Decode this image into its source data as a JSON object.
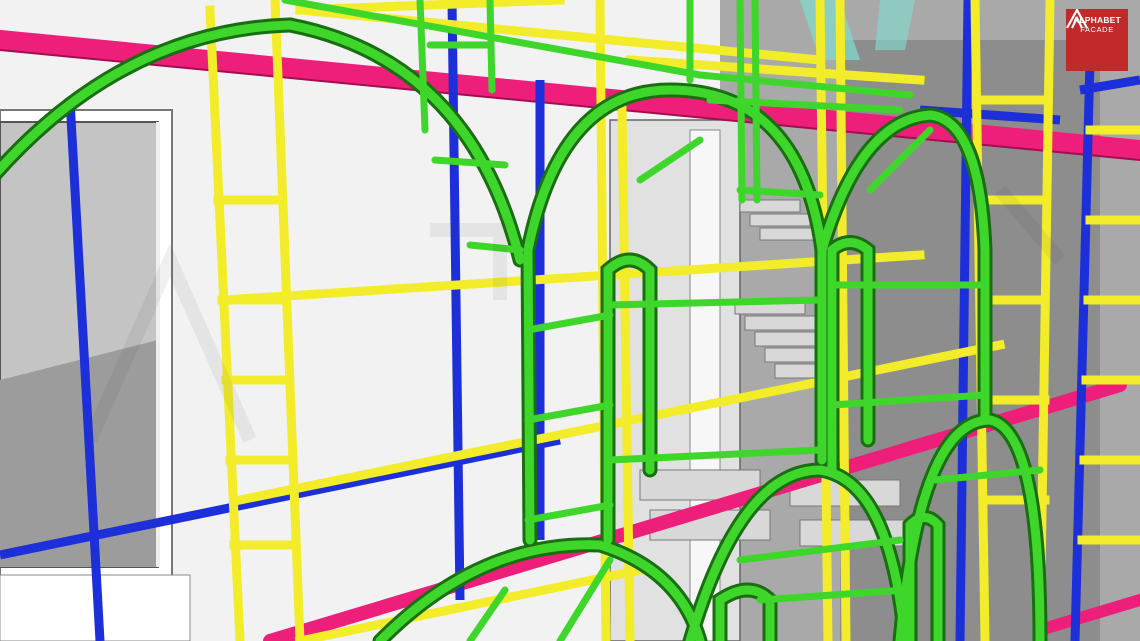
{
  "brand": {
    "name_line1": "ALPHABET",
    "name_line2": "FACADE",
    "icon": "alphabet-logo-icon",
    "badge_color": "#c12a2a"
  },
  "palette": {
    "arch_frame": "#3fd62b",
    "scaffold": "#f2ec2b",
    "post": "#1d2fd8",
    "beam": "#ee1f7a",
    "wall": "#f4f4f4",
    "window_glass": "#b9b9b9",
    "interior": "#9a9a9a"
  }
}
